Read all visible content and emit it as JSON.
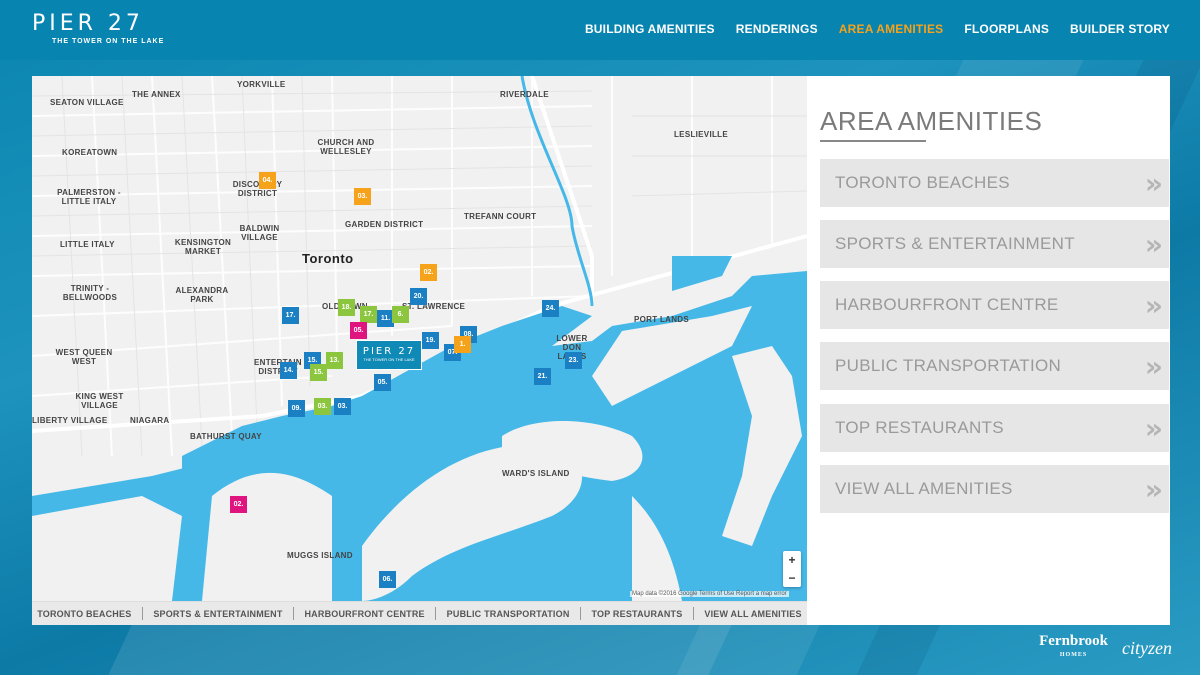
{
  "brand": {
    "name": "PIER 27",
    "tagline": "THE TOWER ON THE LAKE"
  },
  "nav": [
    {
      "label": "BUILDING AMENITIES",
      "active": false
    },
    {
      "label": "RENDERINGS",
      "active": false
    },
    {
      "label": "AREA AMENITIES",
      "active": true
    },
    {
      "label": "FLOORPLANS",
      "active": false
    },
    {
      "label": "BUILDER STORY",
      "active": false
    }
  ],
  "colors": {
    "accent": "#f7a21b",
    "header": "#0784b0",
    "water": "#45b8e8",
    "marker_blue": "#1a7fc3",
    "marker_green": "#8cc63f",
    "marker_pink": "#e0147f",
    "marker_orange": "#f7a21b"
  },
  "map": {
    "city": "Toronto",
    "neighbourhoods": [
      "YORKVILLE",
      "THE ANNEX",
      "SEATON VILLAGE",
      "RIVERDALE",
      "LESLIEVILLE",
      "KOREATOWN",
      "CHURCH AND WELLESLEY",
      "PALMERSTON - LITTLE ITALY",
      "DISCOVERY DISTRICT",
      "BALDWIN VILLAGE",
      "GARDEN DISTRICT",
      "TREFANN COURT",
      "LITTLE ITALY",
      "KENSINGTON MARKET",
      "TRINITY - BELLWOODS",
      "ALEXANDRA PARK",
      "OLD TOWN",
      "ST. LAWRENCE",
      "LOWER DON LANDS",
      "PORT LANDS",
      "WEST QUEEN WEST",
      "ENTERTAINMENT DISTRICT",
      "KING WEST VILLAGE",
      "NIAGARA",
      "LIBERTY VILLAGE",
      "BATHURST QUAY",
      "WARD'S ISLAND",
      "MUGGS ISLAND"
    ],
    "pier_tag": {
      "title": "PIER 27",
      "sub": "THE TOWER ON THE LAKE"
    },
    "markers": [
      {
        "label": "04.",
        "color": "orange"
      },
      {
        "label": "03.",
        "color": "orange"
      },
      {
        "label": "02.",
        "color": "orange"
      },
      {
        "label": "20.",
        "color": "blue"
      },
      {
        "label": "17.",
        "color": "blue"
      },
      {
        "label": "24.",
        "color": "blue"
      },
      {
        "label": "11.",
        "color": "blue"
      },
      {
        "label": "19.",
        "color": "blue"
      },
      {
        "label": "07.",
        "color": "blue"
      },
      {
        "label": "23.",
        "color": "blue"
      },
      {
        "label": "21.",
        "color": "blue"
      },
      {
        "label": "14.",
        "color": "blue"
      },
      {
        "label": "09.",
        "color": "blue"
      },
      {
        "label": "05.",
        "color": "blue"
      },
      {
        "label": "03.",
        "color": "blue"
      },
      {
        "label": "06.",
        "color": "blue"
      },
      {
        "label": "15.",
        "color": "blue"
      },
      {
        "label": "08.",
        "color": "blue"
      },
      {
        "label": "18.",
        "color": "green"
      },
      {
        "label": "17.",
        "color": "green"
      },
      {
        "label": "6.",
        "color": "green"
      },
      {
        "label": "13.",
        "color": "green"
      },
      {
        "label": "15.",
        "color": "green"
      },
      {
        "label": "03.",
        "color": "green"
      },
      {
        "label": "05.",
        "color": "pink"
      },
      {
        "label": "02.",
        "color": "pink"
      },
      {
        "label": "1.",
        "color": "orange"
      }
    ],
    "zoom_in": "+",
    "zoom_out": "−",
    "attribution": "Map data ©2016 Google  Terms of Use  Report a map error"
  },
  "map_tabs": [
    "TORONTO BEACHES",
    "SPORTS & ENTERTAINMENT",
    "HARBOURFRONT CENTRE",
    "PUBLIC TRANSPORTATION",
    "TOP RESTAURANTS",
    "VIEW ALL AMENITIES"
  ],
  "sidebar": {
    "title": "AREA AMENITIES",
    "buttons": [
      "TORONTO BEACHES",
      "SPORTS & ENTERTAINMENT",
      "HARBOURFRONT CENTRE",
      "PUBLIC TRANSPORTATION",
      "TOP RESTAURANTS",
      "VIEW ALL AMENITIES"
    ],
    "chevron": "»"
  },
  "footer": {
    "fernbrook": "Fernbrook",
    "fernbrook_sub": "HOMES",
    "cityzen": "cityzen"
  }
}
